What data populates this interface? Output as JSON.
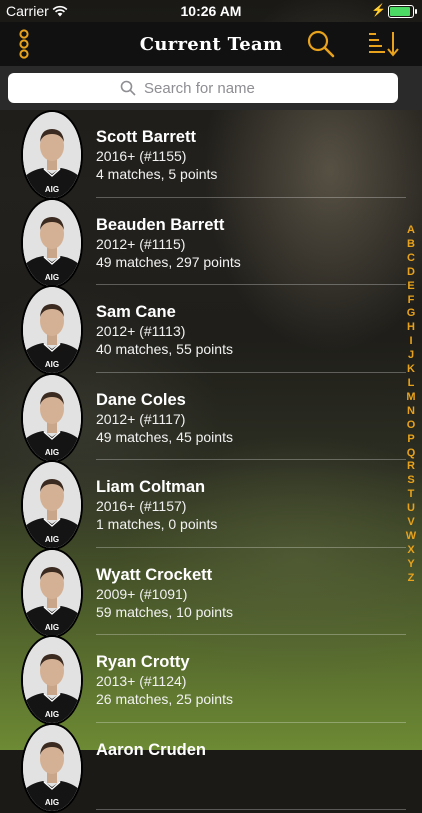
{
  "status_bar": {
    "carrier": "Carrier",
    "time": "10:26 AM"
  },
  "nav": {
    "title": "Current Team",
    "menu_icon": "menu-dots-icon",
    "search_icon": "search-icon",
    "sort_icon": "sort-icon"
  },
  "search": {
    "placeholder": "Search for name",
    "value": ""
  },
  "players": [
    {
      "name": "Scott Barrett",
      "years": "2016+ (#1155)",
      "stats": "4 matches, 5 points"
    },
    {
      "name": "Beauden Barrett",
      "years": "2012+ (#1115)",
      "stats": "49 matches, 297 points"
    },
    {
      "name": "Sam Cane",
      "years": "2012+ (#1113)",
      "stats": "40 matches, 55 points"
    },
    {
      "name": "Dane Coles",
      "years": "2012+ (#1117)",
      "stats": "49 matches, 45 points"
    },
    {
      "name": "Liam Coltman",
      "years": "2016+ (#1157)",
      "stats": "1 matches, 0 points"
    },
    {
      "name": "Wyatt Crockett",
      "years": "2009+ (#1091)",
      "stats": "59 matches, 10 points"
    },
    {
      "name": "Ryan Crotty",
      "years": "2013+ (#1124)",
      "stats": "26 matches, 25 points"
    },
    {
      "name": "Aaron Cruden",
      "years": "",
      "stats": ""
    }
  ],
  "jersey_text": "AIG",
  "index_letters": [
    "A",
    "B",
    "C",
    "D",
    "E",
    "F",
    "G",
    "H",
    "I",
    "J",
    "K",
    "L",
    "M",
    "N",
    "O",
    "P",
    "Q",
    "R",
    "S",
    "T",
    "U",
    "V",
    "W",
    "X",
    "Y",
    "Z"
  ],
  "colors": {
    "accent": "#e8a21c",
    "navbar": "#111111",
    "battery": "#4cd964"
  }
}
